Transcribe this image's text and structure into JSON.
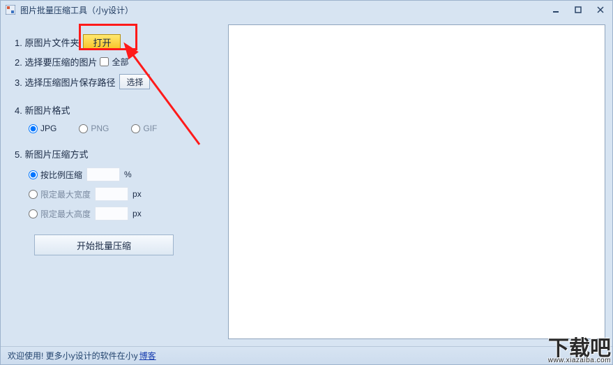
{
  "window": {
    "title": "图片批量压缩工具（小y设计）"
  },
  "controls": {
    "open_btn": "打开",
    "select_btn": "选择",
    "all_label": "全部",
    "start_btn": "开始批量压缩"
  },
  "labels": {
    "r1": "1. 原图片文件夹",
    "r2": "2. 选择要压缩的图片",
    "r3": "3. 选择压缩图片保存路径",
    "r4": "4. 新图片格式",
    "r5": "5. 新图片压缩方式"
  },
  "formats": {
    "jpg": "JPG",
    "png": "PNG",
    "gif": "GIF"
  },
  "compress": {
    "ratio": "按比例压缩",
    "maxw": "限定最大宽度",
    "maxh": "限定最大高度",
    "pct": "%",
    "px": "px"
  },
  "status": {
    "text": "欢迎使用! 更多小y设计的软件在小y ",
    "blog": "博客"
  },
  "watermark": {
    "main": "下载吧",
    "url": "www.xiazaiba.com"
  }
}
